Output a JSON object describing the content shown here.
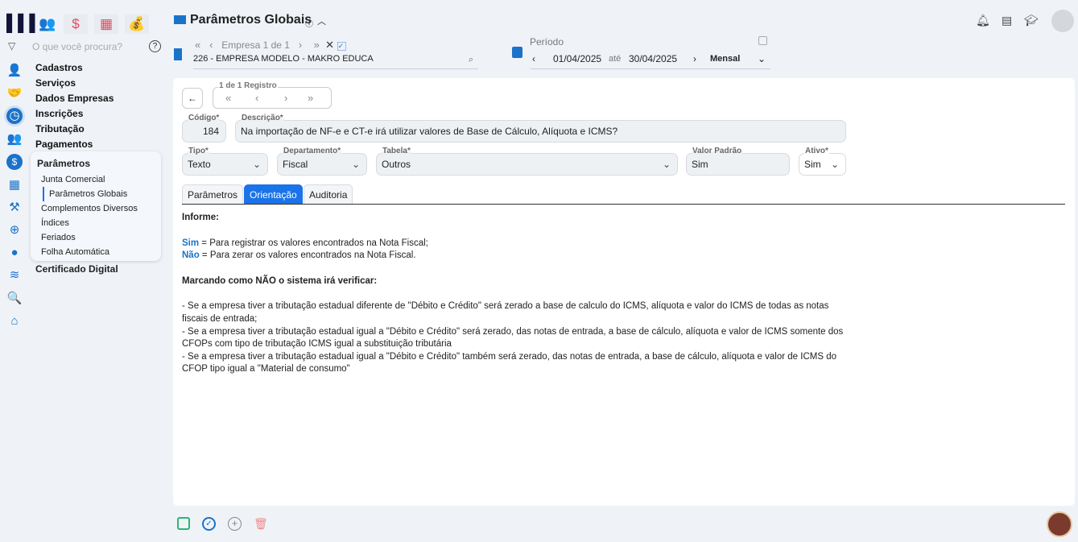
{
  "topbar": {
    "title": "Parâmetros Globais"
  },
  "company": {
    "nav_label": "Empresa 1 de 1",
    "value": "226 - EMPRESA MODELO - MAKRO EDUCA"
  },
  "period": {
    "label": "Período",
    "start": "01/04/2025",
    "between": "até",
    "end": "30/04/2025",
    "mode": "Mensal"
  },
  "search": {
    "placeholder": "O que você procura?"
  },
  "menu": {
    "items": [
      "Cadastros",
      "Serviços",
      "Dados Empresas",
      "Inscrições",
      "Tributação",
      "Pagamentos"
    ],
    "submenu_title": "Parâmetros",
    "submenu": [
      "Junta Comercial",
      "Parâmetros Globais",
      "Complementos Diversos",
      "Índices",
      "Feriados",
      "Folha Automática"
    ],
    "last": "Certificado Digital"
  },
  "record": {
    "nav_label": "1 de 1 Registro"
  },
  "form": {
    "codigo_label": "Código*",
    "codigo": "184",
    "descricao_label": "Descrição*",
    "descricao": "Na importação de NF-e e CT-e irá utilizar valores de Base de Cálculo, Alíquota e ICMS?",
    "tipo_label": "Tipo*",
    "tipo": "Texto",
    "departamento_label": "Departamento*",
    "departamento": "Fiscal",
    "tabela_label": "Tabela*",
    "tabela": "Outros",
    "valor_label": "Valor Padrão",
    "valor": "Sim",
    "ativo_label": "Ativo*",
    "ativo": "Sim"
  },
  "tabs": [
    "Parâmetros",
    "Orientação",
    "Auditoria"
  ],
  "orientation": {
    "heading": "Informe:",
    "sim": "Sim",
    "sim_text": " = Para registrar os valores encontrados na Nota Fiscal;",
    "nao": "Não",
    "nao_text": " = Para zerar os valores encontrados na Nota Fiscal.",
    "heading2": "Marcando como NÃO o sistema irá verificar:",
    "bullets": [
      "- Se a empresa tiver a tributação estadual diferente de \"Débito e Crédito\" será zerado a base de calculo do ICMS, alíquota e valor do ICMS de todas as notas fiscais de entrada;",
      "- Se a empresa tiver a tributação estadual igual a \"Débito e Crédito\" será zerado, das notas de entrada, a base de cálculo, alíquota e valor de ICMS somente dos CFOPs com tipo de tributação ICMS igual a substituição tributária",
      "- Se a empresa tiver a tributação estadual igual a \"Débito e Crédito\" também será zerado, das notas de entrada, a base de cálculo, alíquota e valor de ICMS do CFOP tipo igual a \"Material de consumo\""
    ]
  },
  "colors": {
    "accent": "#1a73e8",
    "brand": "#12123a"
  }
}
